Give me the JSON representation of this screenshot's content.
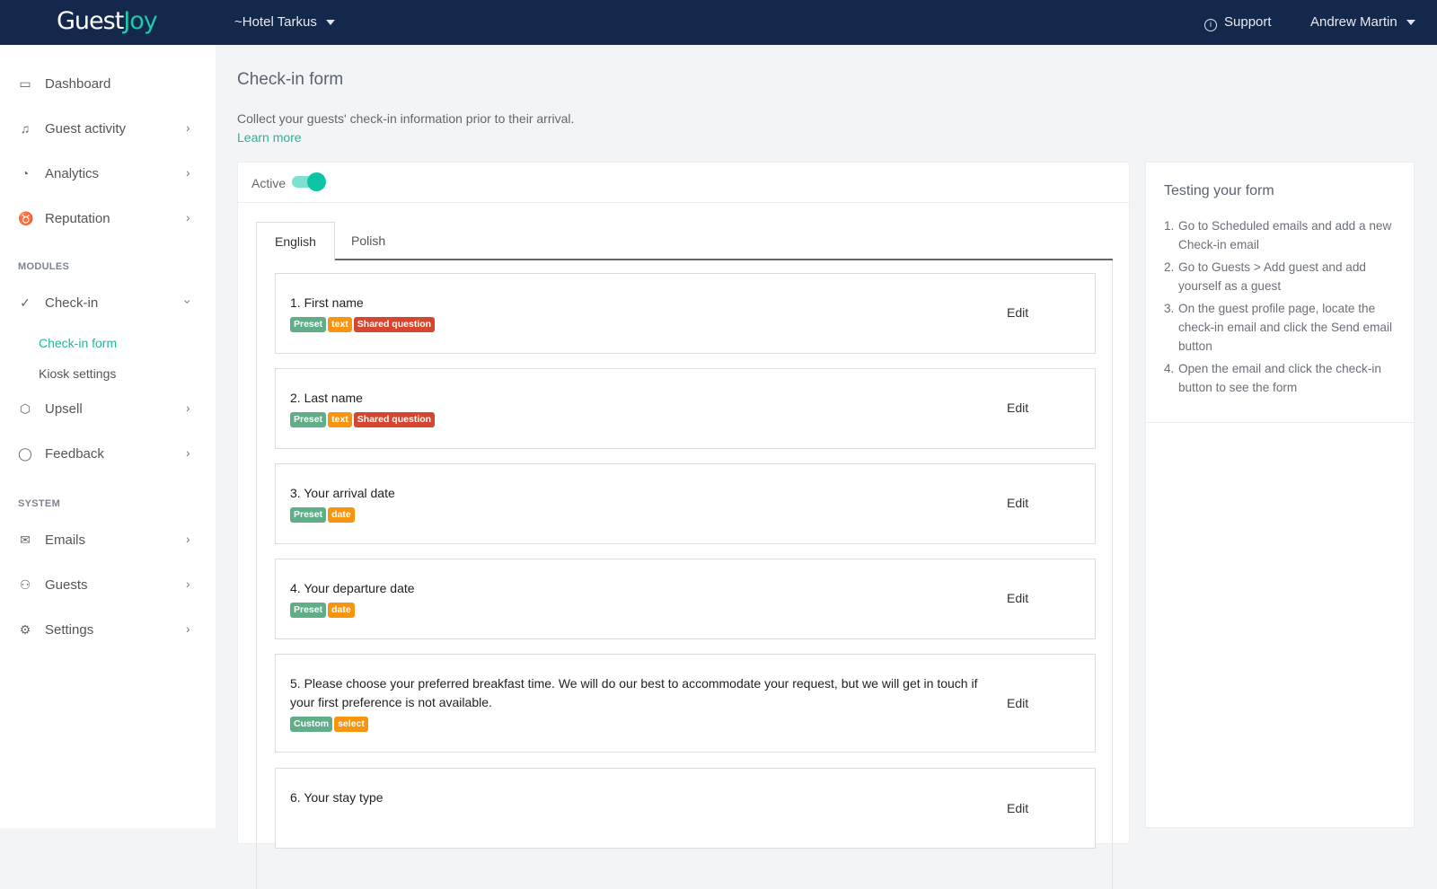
{
  "header": {
    "logo_part1": "Guest",
    "logo_part2": "Joy",
    "hotel": "~Hotel Tarkus",
    "support": "Support",
    "user": "Andrew Martin"
  },
  "sidebar": {
    "items": [
      {
        "label": "Dashboard",
        "icon": "monitor-icon"
      },
      {
        "label": "Guest activity",
        "icon": "bell-icon"
      },
      {
        "label": "Analytics",
        "icon": "pie-chart-icon"
      },
      {
        "label": "Reputation",
        "icon": "award-icon"
      }
    ],
    "modules_label": "MODULES",
    "checkin": {
      "label": "Check-in",
      "subitems": [
        "Check-in form",
        "Kiosk settings"
      ]
    },
    "modules": [
      {
        "label": "Upsell"
      },
      {
        "label": "Feedback"
      }
    ],
    "system_label": "SYSTEM",
    "system": [
      {
        "label": "Emails"
      },
      {
        "label": "Guests"
      },
      {
        "label": "Settings"
      }
    ]
  },
  "page": {
    "title": "Check-in form",
    "description": "Collect your guests' check-in information prior to their arrival.",
    "learn_more": "Learn more",
    "active_label": "Active",
    "active": true,
    "tabs": [
      "English",
      "Polish"
    ],
    "edit_label": "Edit",
    "questions": [
      {
        "text": "1. First name",
        "tags": [
          {
            "label": "Preset",
            "kind": "preset"
          },
          {
            "label": "text",
            "kind": "type"
          },
          {
            "label": "Shared question",
            "kind": "shared"
          }
        ]
      },
      {
        "text": "2. Last name",
        "tags": [
          {
            "label": "Preset",
            "kind": "preset"
          },
          {
            "label": "text",
            "kind": "type"
          },
          {
            "label": "Shared question",
            "kind": "shared"
          }
        ]
      },
      {
        "text": "3. Your arrival date",
        "tags": [
          {
            "label": "Preset",
            "kind": "preset"
          },
          {
            "label": "date",
            "kind": "type"
          }
        ]
      },
      {
        "text": "4. Your departure date",
        "tags": [
          {
            "label": "Preset",
            "kind": "preset"
          },
          {
            "label": "date",
            "kind": "type"
          }
        ]
      },
      {
        "text": "5. Please choose your preferred breakfast time. We will do our best to accommodate your request, but we will get in touch if your first preference is not available.",
        "tags": [
          {
            "label": "Custom",
            "kind": "custom"
          },
          {
            "label": "select",
            "kind": "type"
          }
        ]
      },
      {
        "text": "6. Your stay type",
        "tags": []
      }
    ]
  },
  "testing": {
    "title": "Testing your form",
    "steps": [
      "Go to Scheduled emails and add a new Check-in email",
      "Go to Guests > Add guest and add yourself as a guest",
      "On the guest profile page, locate the check-in email and click the Send email button",
      "Open the email and click the check-in button to see the form"
    ]
  }
}
